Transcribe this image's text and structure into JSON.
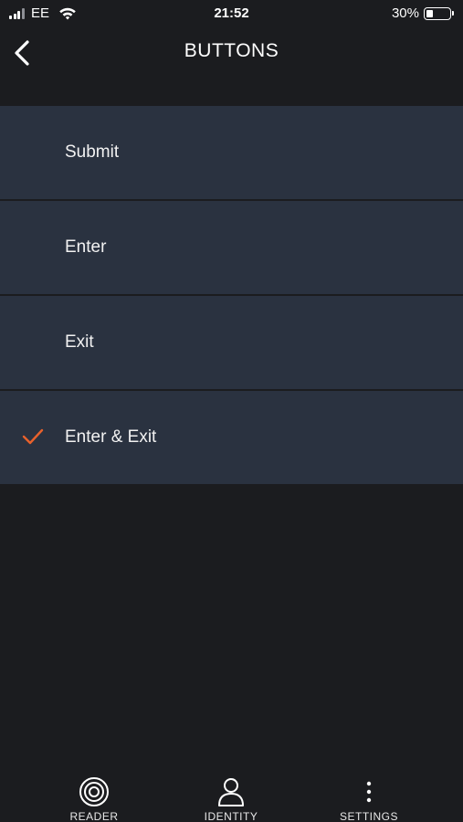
{
  "status_bar": {
    "carrier": "EE",
    "time": "21:52",
    "battery_percent": "30%",
    "battery_level": 0.3,
    "signal_bars": 3
  },
  "nav": {
    "title": "BUTTONS",
    "back_icon": "chevron-left-icon"
  },
  "options": {
    "items": [
      {
        "label": "Submit",
        "selected": false
      },
      {
        "label": "Enter",
        "selected": false
      },
      {
        "label": "Exit",
        "selected": false
      },
      {
        "label": "Enter & Exit",
        "selected": true
      }
    ],
    "check_icon": "checkmark-icon",
    "check_color": "#e8612c"
  },
  "tab_bar": {
    "tabs": [
      {
        "label": "READER",
        "icon": "target-icon"
      },
      {
        "label": "IDENTITY",
        "icon": "person-icon"
      },
      {
        "label": "SETTINGS",
        "icon": "vertical-dots-icon"
      }
    ]
  },
  "colors": {
    "background": "#1b1c1f",
    "row_background": "#2a3240",
    "accent": "#e8612c"
  }
}
